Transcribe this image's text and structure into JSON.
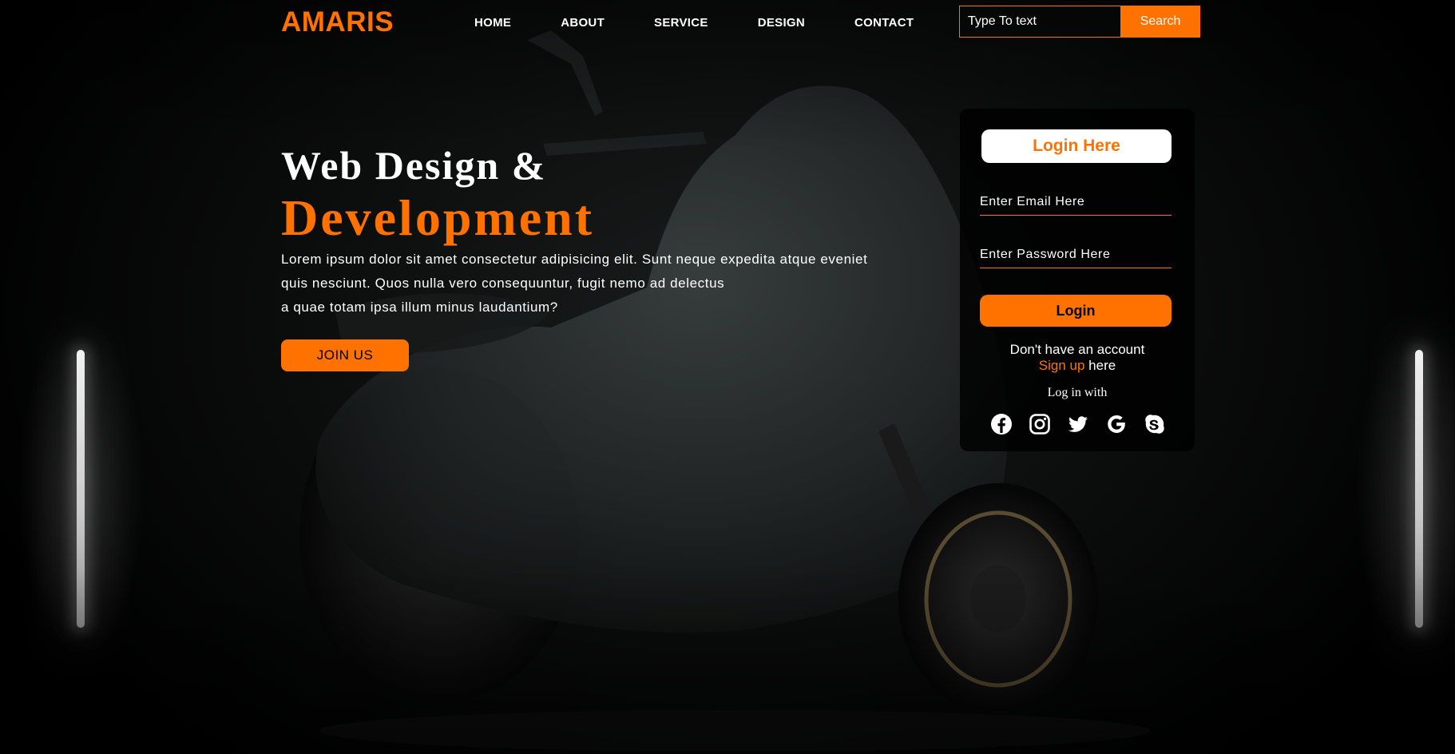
{
  "brand": {
    "logo": "AMARIS",
    "accent": "#ff7200"
  },
  "nav": {
    "items": [
      "HOME",
      "ABOUT",
      "SERVICE",
      "DESIGN",
      "CONTACT"
    ]
  },
  "search": {
    "placeholder": "Type To text",
    "button": "Search"
  },
  "hero": {
    "title_line1": "Web Design &",
    "title_line2": "Development",
    "text_lines": [
      "Lorem ipsum dolor sit amet consectetur adipisicing elit. Sunt neque expedita atque eveniet",
      "quis nesciunt. Quos nulla vero consequuntur, fugit nemo ad delectus",
      "a quae totam ipsa illum minus laudantium?"
    ],
    "join_button": "JOIN US"
  },
  "login": {
    "title": "Login Here",
    "email_placeholder": "Enter Email Here",
    "password_placeholder": "Enter Password Here",
    "button": "Login",
    "no_account": "Don't have an account",
    "signup_link": "Sign up",
    "signup_suffix": " here",
    "login_with": "Log in with",
    "socials": [
      "facebook-icon",
      "instagram-icon",
      "twitter-icon",
      "google-icon",
      "skype-icon"
    ]
  },
  "background": {
    "scene": "motorcycle-scooter-image"
  }
}
